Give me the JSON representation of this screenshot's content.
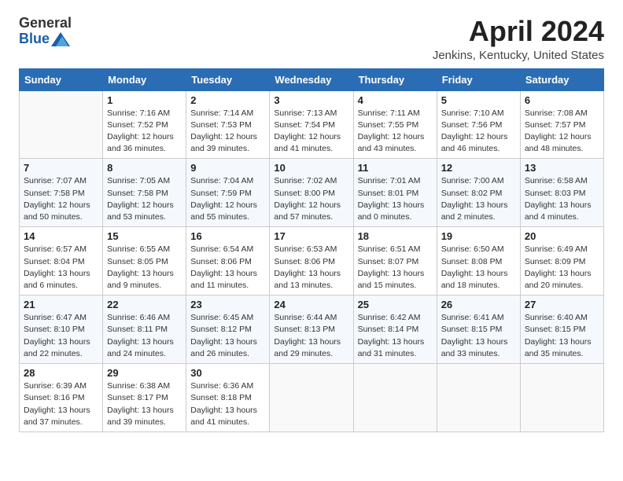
{
  "header": {
    "logo_general": "General",
    "logo_blue": "Blue",
    "title": "April 2024",
    "subtitle": "Jenkins, Kentucky, United States"
  },
  "calendar": {
    "days_of_week": [
      "Sunday",
      "Monday",
      "Tuesday",
      "Wednesday",
      "Thursday",
      "Friday",
      "Saturday"
    ],
    "weeks": [
      [
        {
          "day": "",
          "info": ""
        },
        {
          "day": "1",
          "info": "Sunrise: 7:16 AM\nSunset: 7:52 PM\nDaylight: 12 hours\nand 36 minutes."
        },
        {
          "day": "2",
          "info": "Sunrise: 7:14 AM\nSunset: 7:53 PM\nDaylight: 12 hours\nand 39 minutes."
        },
        {
          "day": "3",
          "info": "Sunrise: 7:13 AM\nSunset: 7:54 PM\nDaylight: 12 hours\nand 41 minutes."
        },
        {
          "day": "4",
          "info": "Sunrise: 7:11 AM\nSunset: 7:55 PM\nDaylight: 12 hours\nand 43 minutes."
        },
        {
          "day": "5",
          "info": "Sunrise: 7:10 AM\nSunset: 7:56 PM\nDaylight: 12 hours\nand 46 minutes."
        },
        {
          "day": "6",
          "info": "Sunrise: 7:08 AM\nSunset: 7:57 PM\nDaylight: 12 hours\nand 48 minutes."
        }
      ],
      [
        {
          "day": "7",
          "info": "Sunrise: 7:07 AM\nSunset: 7:58 PM\nDaylight: 12 hours\nand 50 minutes."
        },
        {
          "day": "8",
          "info": "Sunrise: 7:05 AM\nSunset: 7:58 PM\nDaylight: 12 hours\nand 53 minutes."
        },
        {
          "day": "9",
          "info": "Sunrise: 7:04 AM\nSunset: 7:59 PM\nDaylight: 12 hours\nand 55 minutes."
        },
        {
          "day": "10",
          "info": "Sunrise: 7:02 AM\nSunset: 8:00 PM\nDaylight: 12 hours\nand 57 minutes."
        },
        {
          "day": "11",
          "info": "Sunrise: 7:01 AM\nSunset: 8:01 PM\nDaylight: 13 hours\nand 0 minutes."
        },
        {
          "day": "12",
          "info": "Sunrise: 7:00 AM\nSunset: 8:02 PM\nDaylight: 13 hours\nand 2 minutes."
        },
        {
          "day": "13",
          "info": "Sunrise: 6:58 AM\nSunset: 8:03 PM\nDaylight: 13 hours\nand 4 minutes."
        }
      ],
      [
        {
          "day": "14",
          "info": "Sunrise: 6:57 AM\nSunset: 8:04 PM\nDaylight: 13 hours\nand 6 minutes."
        },
        {
          "day": "15",
          "info": "Sunrise: 6:55 AM\nSunset: 8:05 PM\nDaylight: 13 hours\nand 9 minutes."
        },
        {
          "day": "16",
          "info": "Sunrise: 6:54 AM\nSunset: 8:06 PM\nDaylight: 13 hours\nand 11 minutes."
        },
        {
          "day": "17",
          "info": "Sunrise: 6:53 AM\nSunset: 8:06 PM\nDaylight: 13 hours\nand 13 minutes."
        },
        {
          "day": "18",
          "info": "Sunrise: 6:51 AM\nSunset: 8:07 PM\nDaylight: 13 hours\nand 15 minutes."
        },
        {
          "day": "19",
          "info": "Sunrise: 6:50 AM\nSunset: 8:08 PM\nDaylight: 13 hours\nand 18 minutes."
        },
        {
          "day": "20",
          "info": "Sunrise: 6:49 AM\nSunset: 8:09 PM\nDaylight: 13 hours\nand 20 minutes."
        }
      ],
      [
        {
          "day": "21",
          "info": "Sunrise: 6:47 AM\nSunset: 8:10 PM\nDaylight: 13 hours\nand 22 minutes."
        },
        {
          "day": "22",
          "info": "Sunrise: 6:46 AM\nSunset: 8:11 PM\nDaylight: 13 hours\nand 24 minutes."
        },
        {
          "day": "23",
          "info": "Sunrise: 6:45 AM\nSunset: 8:12 PM\nDaylight: 13 hours\nand 26 minutes."
        },
        {
          "day": "24",
          "info": "Sunrise: 6:44 AM\nSunset: 8:13 PM\nDaylight: 13 hours\nand 29 minutes."
        },
        {
          "day": "25",
          "info": "Sunrise: 6:42 AM\nSunset: 8:14 PM\nDaylight: 13 hours\nand 31 minutes."
        },
        {
          "day": "26",
          "info": "Sunrise: 6:41 AM\nSunset: 8:15 PM\nDaylight: 13 hours\nand 33 minutes."
        },
        {
          "day": "27",
          "info": "Sunrise: 6:40 AM\nSunset: 8:15 PM\nDaylight: 13 hours\nand 35 minutes."
        }
      ],
      [
        {
          "day": "28",
          "info": "Sunrise: 6:39 AM\nSunset: 8:16 PM\nDaylight: 13 hours\nand 37 minutes."
        },
        {
          "day": "29",
          "info": "Sunrise: 6:38 AM\nSunset: 8:17 PM\nDaylight: 13 hours\nand 39 minutes."
        },
        {
          "day": "30",
          "info": "Sunrise: 6:36 AM\nSunset: 8:18 PM\nDaylight: 13 hours\nand 41 minutes."
        },
        {
          "day": "",
          "info": ""
        },
        {
          "day": "",
          "info": ""
        },
        {
          "day": "",
          "info": ""
        },
        {
          "day": "",
          "info": ""
        }
      ]
    ]
  }
}
